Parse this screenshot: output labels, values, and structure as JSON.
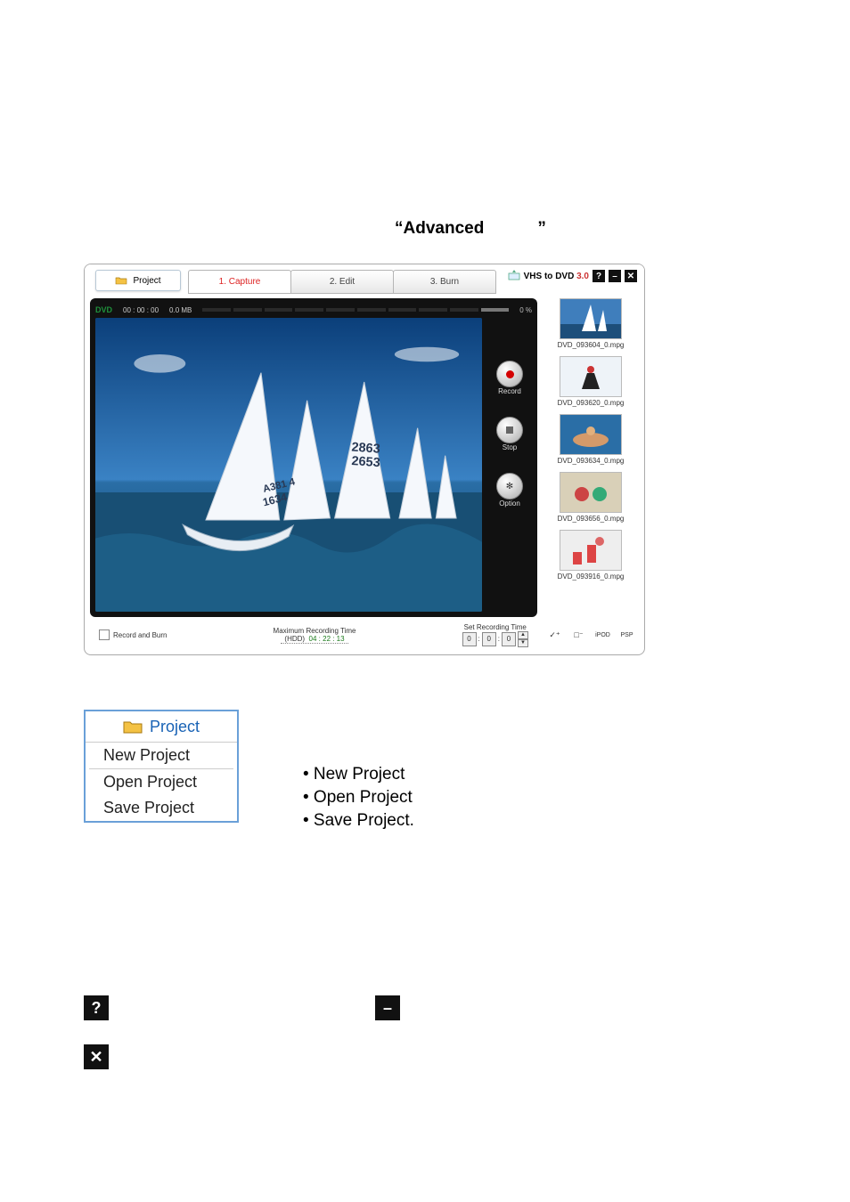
{
  "heading": {
    "open": "“",
    "word": "Advanced",
    "close": "”"
  },
  "app": {
    "projectBtn": "Project",
    "tabs": [
      {
        "label": "1. Capture",
        "active": true
      },
      {
        "label": "2. Edit",
        "active": false
      },
      {
        "label": "3. Burn",
        "active": false
      }
    ],
    "title": {
      "brand": "VHS to DVD ",
      "version": "3.0"
    },
    "winbtns": {
      "help": "?",
      "min": "–",
      "close": "✕"
    },
    "stage": {
      "dvd": "DVD",
      "time": "00 : 00 : 00",
      "size": "0.0 MB",
      "percent": "0 %"
    },
    "controls": {
      "record": "Record",
      "stop": "Stop",
      "option": "Option"
    },
    "clips": [
      {
        "name": "DVD_093604_0.mpg",
        "thumb": "sail"
      },
      {
        "name": "DVD_093620_0.mpg",
        "thumb": "ski"
      },
      {
        "name": "DVD_093634_0.mpg",
        "thumb": "swim"
      },
      {
        "name": "DVD_093656_0.mpg",
        "thumb": "kids"
      },
      {
        "name": "DVD_093916_0.mpg",
        "thumb": "bball"
      }
    ],
    "bottom": {
      "recordAndBurn": "Record and Burn",
      "maxLabel": "Maximum Recording Time",
      "hddPrefix": "(HDD)",
      "hddTime": "04 : 22 : 13",
      "setLabel": "Set Recording Time",
      "t": {
        "h": "0",
        "m": "0",
        "s": "0"
      }
    },
    "brIcons": {
      "a": "✓⁺",
      "b": "□⁻",
      "c": "iPOD",
      "d": "PSP"
    }
  },
  "dropdown": {
    "title": "Project",
    "items": [
      "New Project",
      "Open Project",
      "Save Project"
    ]
  },
  "listText": [
    "• New Project",
    "• Open Project",
    "• Save Project."
  ],
  "bigBtns": {
    "help": "?",
    "min": "–",
    "close": "✕"
  }
}
